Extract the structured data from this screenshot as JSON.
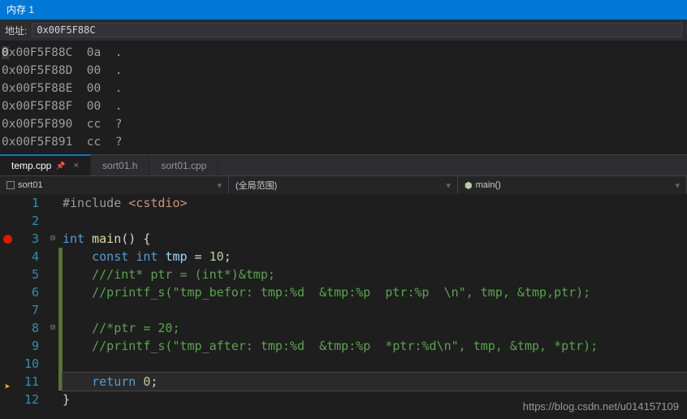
{
  "memory_panel": {
    "title": "内存 1",
    "address_label": "地址:",
    "address_value": "0x00F5F88C",
    "rows": [
      {
        "addr": "0x00F5F88C",
        "hex": "0a",
        "ascii": "."
      },
      {
        "addr": "0x00F5F88D",
        "hex": "00",
        "ascii": "."
      },
      {
        "addr": "0x00F5F88E",
        "hex": "00",
        "ascii": "."
      },
      {
        "addr": "0x00F5F88F",
        "hex": "00",
        "ascii": "."
      },
      {
        "addr": "0x00F5F890",
        "hex": "cc",
        "ascii": "?"
      },
      {
        "addr": "0x00F5F891",
        "hex": "cc",
        "ascii": "?"
      }
    ]
  },
  "tabs": [
    {
      "label": "temp.cpp",
      "active": true,
      "pinned": true
    },
    {
      "label": "sort01.h",
      "active": false
    },
    {
      "label": "sort01.cpp",
      "active": false
    }
  ],
  "breadcrumb": {
    "scope": "sort01",
    "region": "(全局范围)",
    "member": "main()"
  },
  "code": {
    "lines": [
      {
        "n": 1,
        "tokens": [
          [
            "k-pre",
            "#include "
          ],
          [
            "k-str",
            "<cstdio>"
          ]
        ]
      },
      {
        "n": 2,
        "tokens": []
      },
      {
        "n": 3,
        "fold": "⊟",
        "bp": true,
        "tokens": [
          [
            "k-kw",
            "int"
          ],
          [
            "k-punc",
            " "
          ],
          [
            "k-fn",
            "main"
          ],
          [
            "k-punc",
            "() {"
          ]
        ]
      },
      {
        "n": 4,
        "change": true,
        "tokens": [
          [
            "k-punc",
            "    "
          ],
          [
            "k-kw",
            "const"
          ],
          [
            "k-punc",
            " "
          ],
          [
            "k-kw",
            "int"
          ],
          [
            "k-punc",
            " "
          ],
          [
            "k-id",
            "tmp"
          ],
          [
            "k-punc",
            " = "
          ],
          [
            "k-num",
            "10"
          ],
          [
            "k-punc",
            ";"
          ]
        ]
      },
      {
        "n": 5,
        "change": true,
        "tokens": [
          [
            "k-punc",
            "    "
          ],
          [
            "k-comm",
            "///int* ptr = (int*)&tmp;"
          ]
        ]
      },
      {
        "n": 6,
        "change": true,
        "tokens": [
          [
            "k-punc",
            "    "
          ],
          [
            "k-comm",
            "//printf_s(\"tmp_befor: tmp:%d  &tmp:%p  ptr:%p  \\n\", tmp, &tmp,ptr);"
          ]
        ]
      },
      {
        "n": 7,
        "change": true,
        "tokens": []
      },
      {
        "n": 8,
        "change": true,
        "fold": "⊟",
        "tokens": [
          [
            "k-punc",
            "    "
          ],
          [
            "k-comm",
            "//*ptr = 20;"
          ]
        ]
      },
      {
        "n": 9,
        "change": true,
        "tokens": [
          [
            "k-punc",
            "    "
          ],
          [
            "k-comm",
            "//printf_s(\"tmp_after: tmp:%d  &tmp:%p  *ptr:%d\\n\", tmp, &tmp, *ptr);"
          ]
        ]
      },
      {
        "n": 10,
        "change": true,
        "tokens": []
      },
      {
        "n": 11,
        "change": true,
        "current": true,
        "arrow": true,
        "tokens": [
          [
            "k-punc",
            "    "
          ],
          [
            "k-kw",
            "return"
          ],
          [
            "k-punc",
            " "
          ],
          [
            "k-num",
            "0"
          ],
          [
            "k-punc",
            ";"
          ]
        ]
      },
      {
        "n": 12,
        "tokens": [
          [
            "k-punc",
            "}"
          ]
        ]
      }
    ]
  },
  "watermark": "https://blog.csdn.net/u014157109"
}
